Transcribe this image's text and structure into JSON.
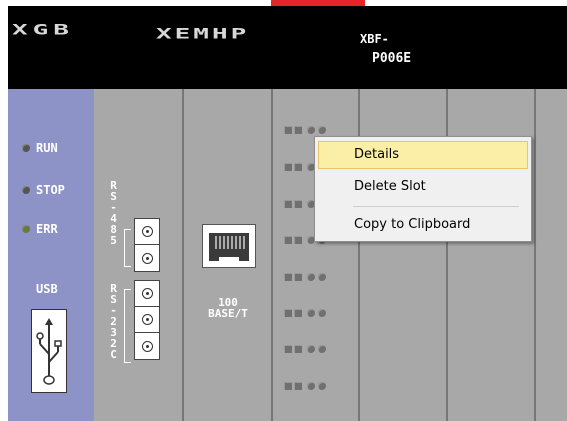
{
  "header": {
    "brand_left": "XGB",
    "brand_right": "XEMHP",
    "model_line1": "XBF-",
    "model_line2": "P006E"
  },
  "cpu": {
    "leds": [
      {
        "label": "RUN",
        "color": "#555555"
      },
      {
        "label": "STOP",
        "color": "#555555"
      },
      {
        "label": "ERR",
        "color": "#6a7a3a"
      }
    ],
    "usb_label": "USB"
  },
  "comm": {
    "rs485": "RS-485",
    "rs232": "RS-232C",
    "ethernet_line1": "100",
    "ethernet_line2": "BASE/T"
  },
  "context_menu": {
    "items": [
      {
        "label": "Details",
        "highlighted": true
      },
      {
        "label": "Delete Slot",
        "highlighted": false
      },
      {
        "label": "Copy to Clipboard",
        "highlighted": false
      }
    ]
  },
  "colors": {
    "header_bg": "#000000",
    "cpu_panel": "#8d93c6",
    "module_panel": "#a8a8a8",
    "accent_red": "#e8242b",
    "menu_highlight": "#fbeea6"
  }
}
